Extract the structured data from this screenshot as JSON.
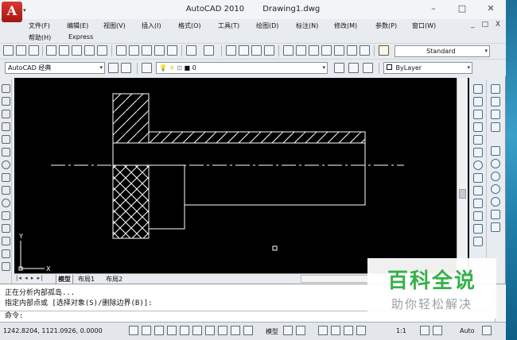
{
  "window": {
    "app_name": "AutoCAD 2010",
    "document_name": "Drawing1.dwg",
    "minimize": "–",
    "maximize": "□",
    "close": "✕",
    "mdi_controls": "_ □ X"
  },
  "menu": {
    "items": [
      "文件(F)",
      "编辑(E)",
      "视图(V)",
      "插入(I)",
      "格式(O)",
      "工具(T)",
      "绘图(D)",
      "标注(N)",
      "修改(M)",
      "参数(P)",
      "窗口(W)"
    ],
    "items_row2": [
      "帮助(H)",
      "Express"
    ]
  },
  "toolbar": {
    "text_style": "Standard",
    "workspace": "AutoCAD 经典",
    "layer": "0",
    "color": "ByLayer"
  },
  "ucs": {
    "x_label": "X",
    "y_label": "Y"
  },
  "tabs": [
    "模型",
    "布局1",
    "布局2"
  ],
  "command": {
    "lines": [
      "正在分析内部孤岛...",
      "指定内部点或 [选择对象(S)/删除边界(B)]:"
    ],
    "prompt": "命令:"
  },
  "status": {
    "coordinates": "1242.8204, 1121.0926, 0.0000",
    "model_label": "模型",
    "scale": "1:1",
    "auto": "Auto"
  },
  "watermark": {
    "title": "百科全说",
    "subtitle": "助你轻松解决"
  },
  "colors": {
    "canvas": "#000000",
    "lines": "#ffffff",
    "app_logo": "#c4251c",
    "watermark_green": "#35b14a"
  }
}
